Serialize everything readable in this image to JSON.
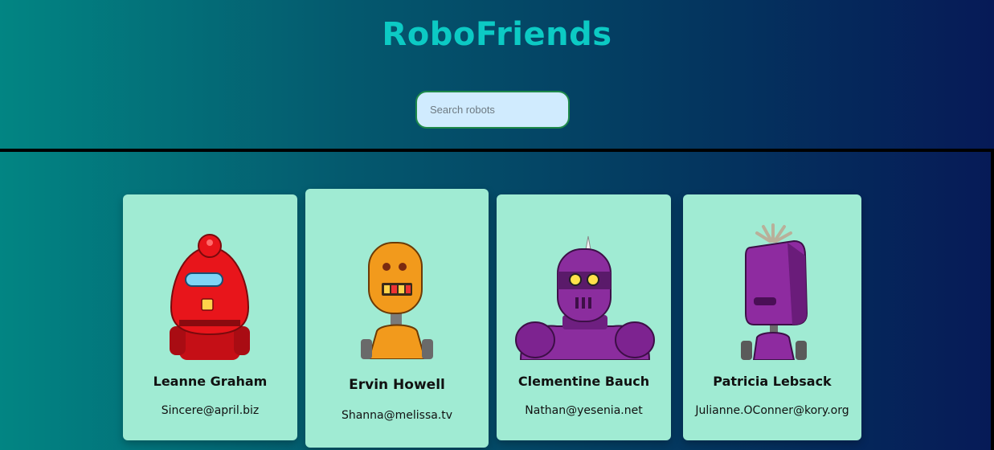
{
  "app": {
    "title": "RoboFriends"
  },
  "search": {
    "placeholder": "Search robots"
  },
  "robots": [
    {
      "name": "Leanne Graham",
      "email": "Sincere@april.biz",
      "color": "#e8151b"
    },
    {
      "name": "Ervin Howell",
      "email": "Shanna@melissa.tv",
      "color": "#f29a1c"
    },
    {
      "name": "Clementine Bauch",
      "email": "Nathan@yesenia.net",
      "color": "#8b2d9e"
    },
    {
      "name": "Patricia Lebsack",
      "email": "Julianne.OConner@kory.org",
      "color": "#8e2ba0"
    }
  ]
}
